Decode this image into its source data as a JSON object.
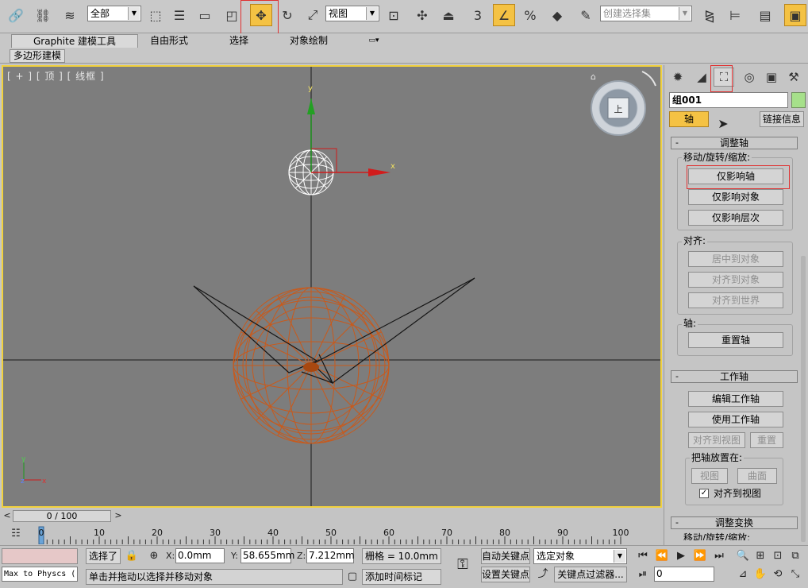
{
  "toolbar": {
    "selection_filter": "全部",
    "ref_coord": "视图",
    "snap_toggle": "3",
    "selection_set_placeholder": "创建选择集"
  },
  "ribbon": {
    "tabs": [
      "Graphite 建模工具",
      "自由形式",
      "选择",
      "对象绘制"
    ],
    "subtab": "多边形建模"
  },
  "viewport": {
    "label": "[ + ] [ 顶 ] [ 线框 ]",
    "nav_cube_face": "上",
    "axis_x": "x",
    "axis_y": "y",
    "axis_z": "z",
    "accent": "#f1d13d"
  },
  "timeline": {
    "slider_text": "0 / 100",
    "prev": "<",
    "next": ">",
    "ruler_ticks": [
      "0",
      "10",
      "20",
      "30",
      "40",
      "50",
      "60",
      "70",
      "80",
      "90",
      "100"
    ]
  },
  "command_panel": {
    "object_name": "组001",
    "pivot_button": "轴",
    "link_info_button": "链接信息",
    "adjust_pivot_title": "调整轴",
    "move_group_label": "移动/旋转/缩放:",
    "affect_pivot_only": "仅影响轴",
    "affect_object_only": "仅影响对象",
    "affect_hierarchy_only": "仅影响层次",
    "align_group_label": "对齐:",
    "center_to_object": "居中到对象",
    "align_to_object": "对齐到对象",
    "align_to_world": "对齐到世界",
    "pivot_group_label": "轴:",
    "reset_pivot": "重置轴",
    "working_pivot_title": "工作轴",
    "edit_working_pivot": "编辑工作轴",
    "use_working_pivot": "使用工作轴",
    "align_to_view": "对齐到视图",
    "reset": "重置",
    "place_pivot_label": "把轴放置在:",
    "view": "视图",
    "surface": "曲面",
    "align_to_view_check": "对齐到视图",
    "adjust_transform_title": "调整变换",
    "adjust_transform_sub": "移动/旋转/缩放:"
  },
  "status": {
    "script_listener": "Max to Physcs (",
    "selected_text": "选择了",
    "x_label": "X:",
    "x_value": "0.0mm",
    "y_label": "Y:",
    "y_value": "58.655mm",
    "z_label": "Z:",
    "z_value": "7.212mm",
    "grid_text": "栅格 = 10.0mm",
    "prompt": "单击并拖动以选择并移动对象",
    "add_time_tag": "添加时间标记",
    "auto_key": "自动关键点",
    "set_key": "设置关键点",
    "key_mode": "选定对象",
    "key_filters": "关键点过滤器...",
    "frame": "0"
  }
}
